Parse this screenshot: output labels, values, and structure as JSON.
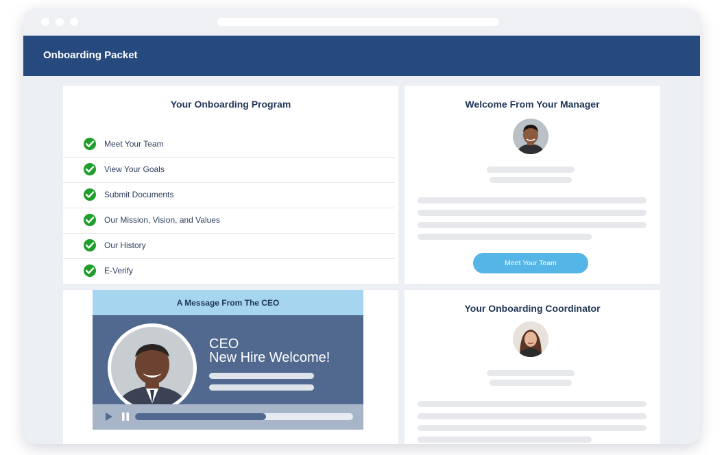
{
  "app": {
    "title": "Onboarding Packet"
  },
  "program": {
    "title": "Your Onboarding Program",
    "items": [
      {
        "label": "Meet Your Team"
      },
      {
        "label": "View Your Goals"
      },
      {
        "label": "Submit Documents"
      },
      {
        "label": "Our Mission, Vision, and Values"
      },
      {
        "label": "Our History"
      },
      {
        "label": "E-Verify"
      }
    ]
  },
  "manager": {
    "title": "Welcome From Your Manager",
    "button_label": "Meet Your Team"
  },
  "ceo": {
    "banner": "A Message From The CEO",
    "line1": "CEO",
    "line2": "New Hire Welcome!",
    "progress": 0.6
  },
  "coordinator": {
    "title": "Your Onboarding Coordinator"
  },
  "colors": {
    "header": "#264a7e",
    "check": "#1f9e2c",
    "button": "#55b5e6",
    "ceo_banner": "#a6d5ef",
    "ceo_panel": "#51698f"
  },
  "icons": {
    "check": "check-circle-icon",
    "play": "play-icon",
    "pause": "pause-icon"
  }
}
